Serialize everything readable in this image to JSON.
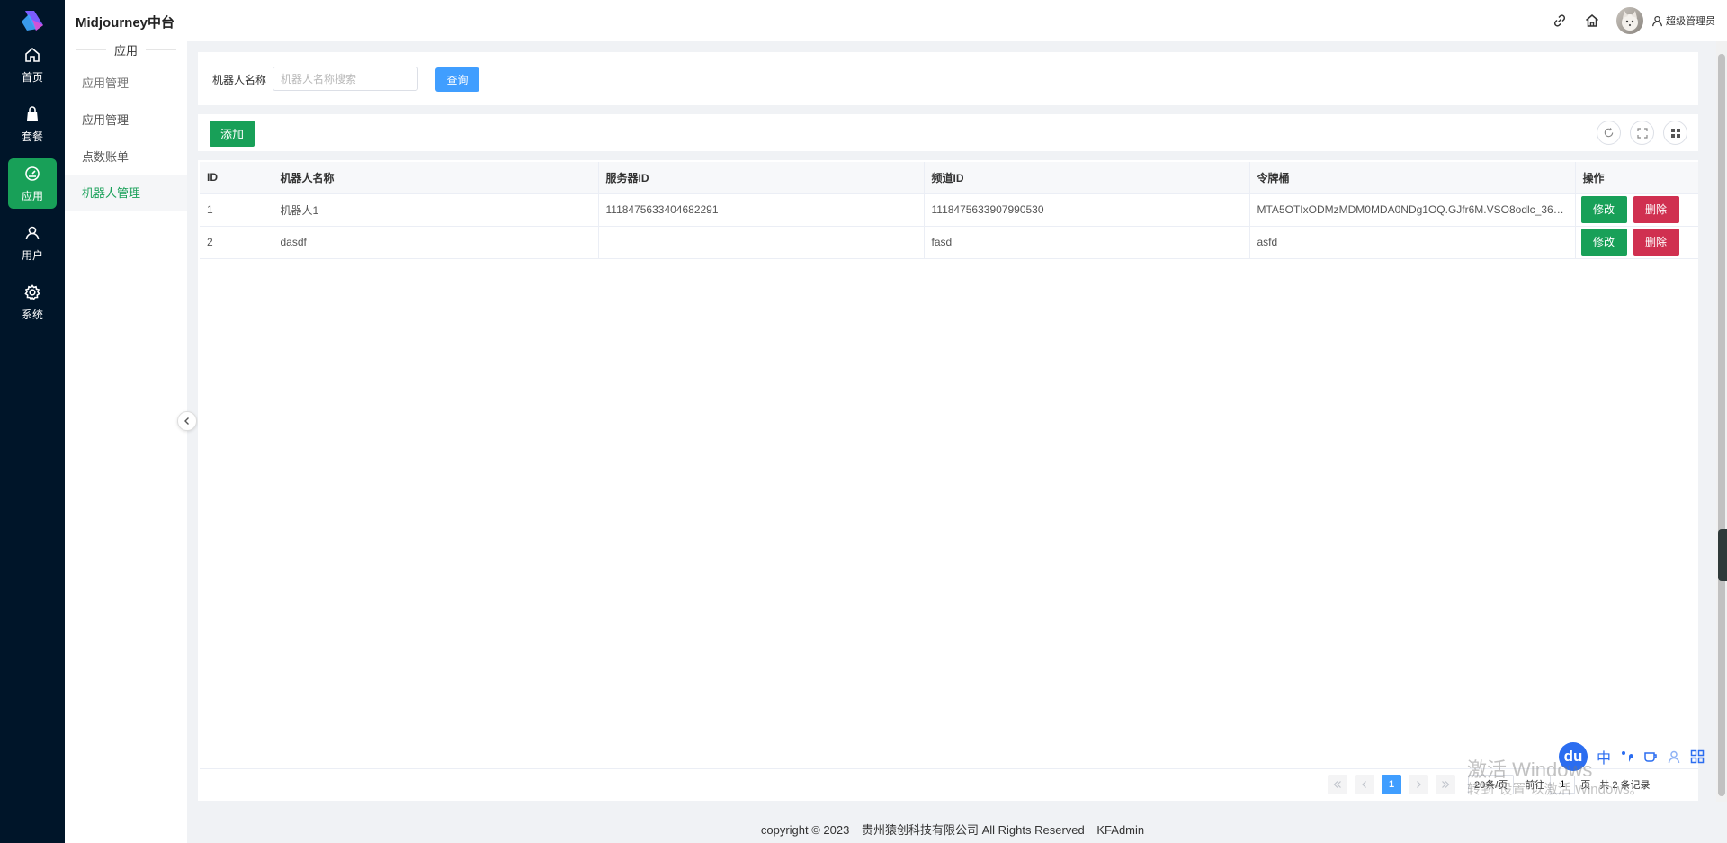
{
  "app": {
    "title": "Midjourney中台"
  },
  "nav": {
    "items": [
      {
        "label": "首页",
        "icon": "home-icon"
      },
      {
        "label": "套餐",
        "icon": "bag-icon"
      },
      {
        "label": "应用",
        "icon": "gauge-icon",
        "active": true
      },
      {
        "label": "用户",
        "icon": "user-icon"
      },
      {
        "label": "系统",
        "icon": "gear-icon"
      }
    ]
  },
  "menu": {
    "group": "应用",
    "items": [
      {
        "label": "应用管理"
      },
      {
        "label": "应用管理"
      },
      {
        "label": "点数账单"
      },
      {
        "label": "机器人管理",
        "active": true
      }
    ]
  },
  "header": {
    "username": "超级管理员"
  },
  "search": {
    "label": "机器人名称",
    "placeholder": "机器人名称搜索",
    "button": "查询"
  },
  "toolbar": {
    "add_label": "添加"
  },
  "table": {
    "columns": [
      "ID",
      "机器人名称",
      "服务器ID",
      "频道ID",
      "令牌桶",
      "操作"
    ],
    "rows": [
      {
        "id": "1",
        "name": "机器人1",
        "server_id": "1118475633404682291",
        "channel_id": "1118475633907990530",
        "token": "MTA5OTIxODMzMDM0MDA0NDg1OQ.GJfr6M.VSO8odlc_36pYO..."
      },
      {
        "id": "2",
        "name": "dasdf",
        "server_id": "",
        "channel_id": "fasd",
        "token": "asfd"
      }
    ],
    "edit_label": "修改",
    "delete_label": "删除"
  },
  "pagination": {
    "current_page": "1",
    "page_size": "20条/页",
    "goto_label": "前往",
    "goto_value": "1",
    "page_unit": "页",
    "total": "共 2 条记录"
  },
  "footer": {
    "copyright": "copyright © 2023",
    "company": "贵州猿创科技有限公司 All Rights Reserved",
    "brand": "KFAdmin"
  },
  "ime": {
    "logo": "du",
    "mode": "中"
  },
  "watermark": {
    "line1": "激活 Windows",
    "line2": "转到\"设置\"以激活 Windows。"
  },
  "colors": {
    "accent": "#18a058",
    "primary": "#409eff",
    "danger": "#d03050",
    "sidebar": "#001529"
  }
}
